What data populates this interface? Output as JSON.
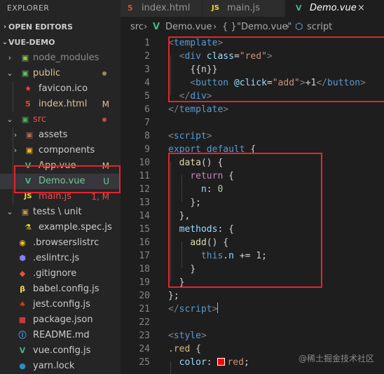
{
  "sidebar": {
    "title": "EXPLORER",
    "open_editors": "OPEN EDITORS",
    "project": "VUE-DEMO",
    "items": [
      {
        "label": "node_modules",
        "icon": "node-folder-icon",
        "status": ""
      },
      {
        "label": "public",
        "icon": "public-folder-icon",
        "status": "dot"
      },
      {
        "label": "favicon.ico",
        "icon": "favicon-icon",
        "status": ""
      },
      {
        "label": "index.html",
        "icon": "html-file-icon",
        "status": "M"
      },
      {
        "label": "src",
        "icon": "src-folder-icon",
        "status": "dot"
      },
      {
        "label": "assets",
        "icon": "assets-folder-icon",
        "status": ""
      },
      {
        "label": "components",
        "icon": "components-folder-icon",
        "status": ""
      },
      {
        "label": "App.vue",
        "icon": "vue-file-icon",
        "status": "M"
      },
      {
        "label": "Demo.vue",
        "icon": "vue-file-icon",
        "status": "U"
      },
      {
        "label": "main.js",
        "icon": "js-file-icon",
        "status": "1, M"
      },
      {
        "label": "tests \\ unit",
        "icon": "folder-icon",
        "status": ""
      },
      {
        "label": "example.spec.js",
        "icon": "test-file-icon",
        "status": ""
      },
      {
        "label": ".browserslistrc",
        "icon": "browserslist-icon",
        "status": ""
      },
      {
        "label": ".eslintrc.js",
        "icon": "eslint-icon",
        "status": ""
      },
      {
        "label": ".gitignore",
        "icon": "git-icon",
        "status": ""
      },
      {
        "label": "babel.config.js",
        "icon": "babel-icon",
        "status": ""
      },
      {
        "label": "jest.config.js",
        "icon": "jest-icon",
        "status": ""
      },
      {
        "label": "package.json",
        "icon": "npm-icon",
        "status": ""
      },
      {
        "label": "README.md",
        "icon": "info-icon",
        "status": ""
      },
      {
        "label": "vue.config.js",
        "icon": "vue-config-icon",
        "status": ""
      },
      {
        "label": "yarn.lock",
        "icon": "yarn-icon",
        "status": ""
      }
    ]
  },
  "tabs": [
    {
      "label": "index.html",
      "icon": "html-file-icon",
      "icon_text": "5"
    },
    {
      "label": "main.js",
      "icon": "js-file-icon",
      "icon_text": "JS"
    },
    {
      "label": "Demo.vue",
      "icon": "vue-file-icon",
      "icon_text": "V",
      "active": true
    }
  ],
  "tab_close": "×",
  "breadcrumb": {
    "src": "src",
    "file": "Demo.vue",
    "symbol_icon": "{ }",
    "symbol": "\"Demo.vue\"",
    "section": "script"
  },
  "editor": {
    "line_numbers": [
      "1",
      "2",
      "3",
      "4",
      "5",
      "6",
      "7",
      "8",
      "9",
      "10",
      "11",
      "12",
      "13",
      "14",
      "15",
      "16",
      "17",
      "18",
      "19",
      "20",
      "21",
      "22",
      "23",
      "24",
      "25"
    ],
    "code": {
      "l1_open": "<",
      "l1_tag": "template",
      "l1_close": ">",
      "l2_open": "<",
      "l2_tag": "div",
      "l2_attr": "class",
      "l2_eq": "=",
      "l2_val": "\"red\"",
      "l2_close": ">",
      "l3": "{{n}}",
      "l4_open": "<",
      "l4_tag": "button",
      "l4_attr": "@click",
      "l4_eq": "=",
      "l4_val": "\"add\"",
      "l4_gt": ">",
      "l4_text": "+1",
      "l4_ctag": "</",
      "l4_tag2": "button",
      "l4_cgt": ">",
      "l5_open": "</",
      "l5_tag": "div",
      "l5_close": ">",
      "l6_open": "</",
      "l6_tag": "template",
      "l6_close": ">",
      "l8_open": "<",
      "l8_tag": "script",
      "l8_close": ">",
      "l9_kw": "export",
      "l9_kw2": "default",
      "l9_rest": " {",
      "l10_fn": "data",
      "l10_rest": "() {",
      "l11_kw": "return",
      "l11_rest": " {",
      "l12_prop": "n",
      "l12_colon": ": ",
      "l12_num": "0",
      "l13": "};",
      "l14": "},",
      "l15_prop": "methods",
      "l15_rest": ": {",
      "l16_fn": "add",
      "l16_rest": "() {",
      "l17_this": "this",
      "l17_dot": ".",
      "l17_prop": "n",
      "l17_op": " += ",
      "l17_num": "1",
      "l17_end": ";",
      "l18": "}",
      "l19": "}",
      "l20": "};",
      "l21_open": "</",
      "l21_tag": "script",
      "l21_close": ">",
      "l23_open": "<",
      "l23_tag": "style",
      "l23_close": ">",
      "l24_sel": ".red",
      "l24_rest": " {",
      "l25_prop": "color",
      "l25_colon": ": ",
      "l25_val": "red",
      "l25_end": ";"
    }
  },
  "watermark": "@稀土掘金技术社区",
  "colors": {
    "background": "#1e1e1e",
    "sidebar": "#252526",
    "highlight_box": "#e5252b",
    "modified": "#e2c08d",
    "untracked": "#73c991",
    "error": "#f14c4c"
  }
}
